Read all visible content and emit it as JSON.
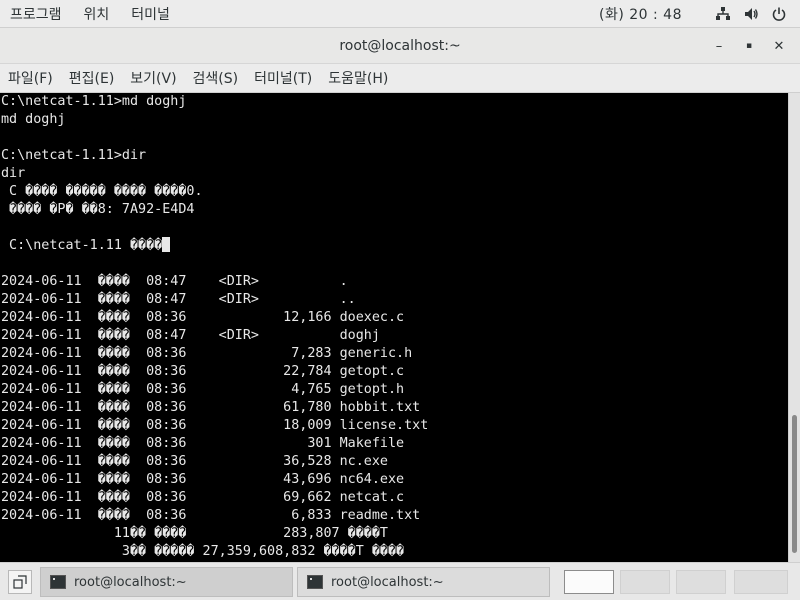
{
  "topbar": {
    "apps_label": "프로그램",
    "places_label": "위치",
    "terminal_label": "터미널",
    "clock": "(화) 20 : 48",
    "icons": [
      "network-icon",
      "volume-icon",
      "power-icon"
    ]
  },
  "window": {
    "title": "root@localhost:~",
    "minimize_label": "–",
    "maximize_label": "▪",
    "close_label": "✕"
  },
  "menubar": {
    "items": [
      {
        "label": "파일(F)"
      },
      {
        "label": "편집(E)"
      },
      {
        "label": "보기(V)"
      },
      {
        "label": "검색(S)"
      },
      {
        "label": "터미널(T)"
      },
      {
        "label": "도움말(H)"
      }
    ]
  },
  "terminal": {
    "lines": [
      "C:\\netcat-1.11>md doghj",
      "md doghj",
      "",
      "C:\\netcat-1.11>dir",
      "dir",
      " C ���� ����� ���� ����0.",
      " ���� �P� ��8: 7A92-E4D4",
      "",
      " C:\\netcat-1.11 ����",
      "",
      "2024-06-11  ����  08:47    <DIR>          .",
      "2024-06-11  ����  08:47    <DIR>          ..",
      "2024-06-11  ����  08:36            12,166 doexec.c",
      "2024-06-11  ����  08:47    <DIR>          doghj",
      "2024-06-11  ����  08:36             7,283 generic.h",
      "2024-06-11  ����  08:36            22,784 getopt.c",
      "2024-06-11  ����  08:36             4,765 getopt.h",
      "2024-06-11  ����  08:36            61,780 hobbit.txt",
      "2024-06-11  ����  08:36            18,009 license.txt",
      "2024-06-11  ����  08:36               301 Makefile",
      "2024-06-11  ����  08:36            36,528 nc.exe",
      "2024-06-11  ����  08:36            43,696 nc64.exe",
      "2024-06-11  ����  08:36            69,662 netcat.c",
      "2024-06-11  ����  08:36             6,833 readme.txt",
      "              11�� ����            283,807 ����T",
      "               3�� ����� 27,359,608,832 ����T ����"
    ]
  },
  "taskbar": {
    "tasks": [
      {
        "label": "root@localhost:~"
      },
      {
        "label": "root@localhost:~"
      }
    ]
  }
}
